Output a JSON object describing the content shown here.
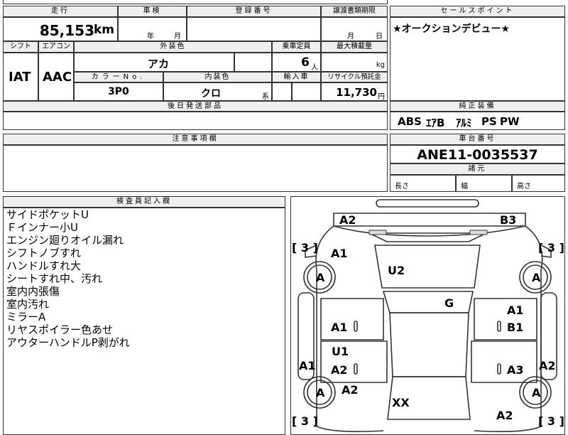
{
  "top": {
    "mileage_label": "走行",
    "mileage_value": "85,153",
    "mileage_unit": "km",
    "inspection_label": "車検",
    "inspection_year": "年",
    "inspection_month": "月",
    "registration_label": "登録番号",
    "transfer_label": "譲渡書類期限",
    "transfer_month": "月",
    "transfer_day": "日",
    "sales_label": "セールスポイント",
    "sales_text": "★オークションデビュー★"
  },
  "specs": {
    "shift_label": "シフト",
    "ac_label": "エアコン",
    "exterior_label": "外装色",
    "exterior_value": "アカ",
    "capacity_label": "乗車定員",
    "capacity_value": "6",
    "capacity_unit": "人",
    "maxload_label": "最大積載量",
    "maxload_unit": "kg",
    "shift_value": "IAT",
    "ac_value": "AAC",
    "color_no_label": "カラーNo.",
    "color_no_value": "3P0",
    "interior_label": "内装色",
    "interior_value": "クロ",
    "interior_suffix": "系",
    "import_label": "輸入車",
    "recycle_label": "リサイクル預託金",
    "recycle_value": "11,730",
    "recycle_unit": "円",
    "later_parts_label": "後日発送部品"
  },
  "equipment": {
    "label": "純正装備",
    "items": [
      "ABS",
      "ｴｱB",
      "ｱﾙﾐ",
      "PS",
      "PW"
    ]
  },
  "notes_label": "注意事項欄",
  "chassis": {
    "label": "車台番号",
    "value": "ANE11-0035537",
    "dims_label": "諸元",
    "length_label": "長さ",
    "width_label": "幅",
    "height_label": "高さ"
  },
  "inspector": {
    "label": "検査員記入欄",
    "lines": [
      "サイドポケットU",
      "Ｆインナー小U",
      "エンジン廻りオイル漏れ",
      "シフトノブすれ",
      "ハンドルすれ大",
      "シートすれ中、汚れ",
      "室内内張傷",
      "室内汚れ",
      "ミラーA",
      "リヤスポイラー色あせ",
      "アウターハンドルP剥がれ"
    ]
  },
  "diagram": {
    "tire_grade": "[ 3 ]",
    "wheel_mark": "A",
    "marks": {
      "front_left": "A2",
      "front_right": "B3",
      "hood_left": "A1",
      "windshield": "U2",
      "roof": "G",
      "front_door_left": "A1",
      "front_door_right_a": "A1",
      "front_door_right_b": "B1",
      "rear_door_left_a": "U1",
      "rear_door_left_b": "A2",
      "rear_door_right": "A3",
      "side_left": "A1",
      "side_right": "A2",
      "rear_quarter_left": "A2",
      "rear_window": "XX",
      "rear_right": "A2"
    }
  }
}
